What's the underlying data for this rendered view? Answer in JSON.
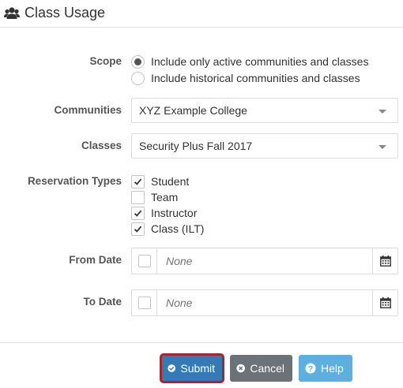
{
  "header": {
    "title": "Class Usage",
    "icon": "users-icon"
  },
  "scope": {
    "label": "Scope",
    "options": [
      {
        "label": "Include only active communities and classes",
        "selected": true
      },
      {
        "label": "Include historical communities and classes",
        "selected": false
      }
    ]
  },
  "communities": {
    "label": "Communities",
    "value": "XYZ Example College"
  },
  "classes": {
    "label": "Classes",
    "value": "Security Plus Fall 2017"
  },
  "reservation_types": {
    "label": "Reservation Types",
    "items": [
      {
        "label": "Student",
        "checked": true
      },
      {
        "label": "Team",
        "checked": false
      },
      {
        "label": "Instructor",
        "checked": true
      },
      {
        "label": "Class (ILT)",
        "checked": true
      }
    ]
  },
  "from_date": {
    "label": "From Date",
    "placeholder": "None",
    "value": ""
  },
  "to_date": {
    "label": "To Date",
    "placeholder": "None",
    "value": ""
  },
  "buttons": {
    "submit": "Submit",
    "cancel": "Cancel",
    "help": "Help"
  },
  "colors": {
    "submit": "#337ab7",
    "submit_focus_outline": "#a8242a",
    "cancel": "#6b7278",
    "help": "#5bb0e0"
  }
}
